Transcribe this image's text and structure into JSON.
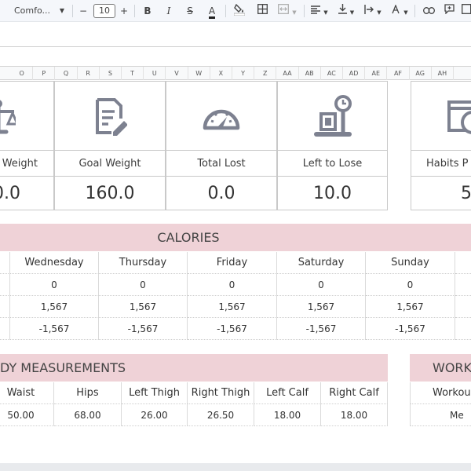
{
  "toolbar": {
    "font_name": "Comfo...",
    "font_size": "10",
    "minus": "−",
    "plus": "+",
    "bold": "B",
    "italic": "I",
    "strike": "S",
    "text_color": "A"
  },
  "columns": [
    "O",
    "P",
    "Q",
    "R",
    "S",
    "T",
    "U",
    "V",
    "W",
    "X",
    "Y",
    "Z",
    "AA",
    "AB",
    "AC",
    "AD",
    "AE",
    "AF",
    "AG",
    "AH"
  ],
  "stats": [
    {
      "label": "Weight",
      "value": "0.0",
      "icon": "scale-icon"
    },
    {
      "label": "Goal Weight",
      "value": "160.0",
      "icon": "document-edit-icon"
    },
    {
      "label": "Total Lost",
      "value": "0.0",
      "icon": "gauge-icon"
    },
    {
      "label": "Left to Lose",
      "value": "10.0",
      "icon": "weigh-station-icon"
    },
    {
      "label": "Habits P",
      "value": "5",
      "icon": "calendar-clock-icon"
    }
  ],
  "calories": {
    "title": "CALORIES",
    "days": [
      "Wednesday",
      "Thursday",
      "Friday",
      "Saturday",
      "Sunday"
    ],
    "row1": [
      "0",
      "0",
      "0",
      "0",
      "0"
    ],
    "row2": [
      "1,567",
      "1,567",
      "1,567",
      "1,567",
      "1,567"
    ],
    "row3": [
      "-1,567",
      "-1,567",
      "-1,567",
      "-1,567",
      "-1,567"
    ]
  },
  "measurements": {
    "title": "DY MEASUREMENTS",
    "headers": [
      "Waist",
      "Hips",
      "Left Thigh",
      "Right Thigh",
      "Left Calf",
      "Right Calf"
    ],
    "values": [
      "50.00",
      "68.00",
      "26.00",
      "26.50",
      "18.00",
      "18.00"
    ]
  },
  "workout": {
    "title": "WORK",
    "header": "Workou",
    "value": "Me"
  },
  "colors": {
    "accent_pink": "#efd2d7",
    "icon_gray": "#7d8190"
  }
}
